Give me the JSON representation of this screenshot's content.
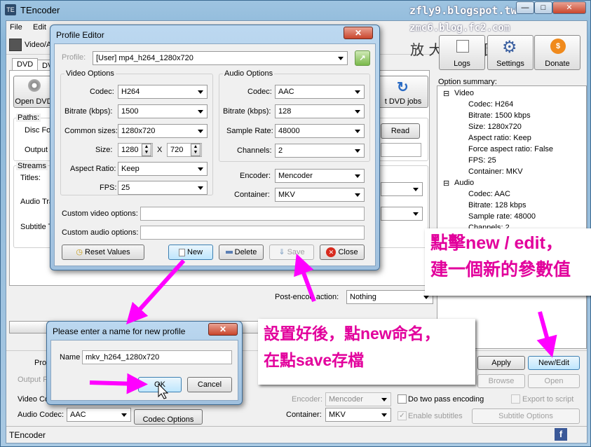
{
  "app": {
    "title": "TEncoder",
    "status": "TEncoder",
    "icon": "TE"
  },
  "watermark": {
    "line1": "zfly9.blogspot.tw",
    "line2": "zmc6.blog.fc2.com",
    "magnifier": "放 大 檢 視 圖"
  },
  "caption_buttons": {
    "min": "—",
    "max": "□",
    "close": "✕"
  },
  "menu": [
    "File",
    "Edit",
    "Tools",
    "Help"
  ],
  "toolbar": {
    "tab_label": "Video/A",
    "dvd_tab": "DVD",
    "dvd_tab2": "DV"
  },
  "main": {
    "open_dvd": "Open DVD",
    "dvd_jobs": "t DVD jobs",
    "paths": "Paths:",
    "disc_folder": "Disc Fo",
    "output": "Output",
    "read": "Read",
    "streams": "Streams",
    "titles": "Titles:",
    "audio_track": "Audio Tra",
    "subtitle_track": "Subtitle T",
    "post_encode_label": "Post-encod",
    "post_encode_label2": "action:",
    "post_encode_value": "Nothing",
    "profile_label": "Profi",
    "output_profile_label": "Output P",
    "video_codec_label": "Video Codec:",
    "audio_codec_label": "Audio Codec:",
    "audio_codec_value": "AAC",
    "codec_options": "Codec Options",
    "encoder_label": "Encoder:",
    "encoder_value": "Mencoder",
    "container_label": "Container:",
    "container_value": "MKV",
    "two_pass": "Do two pass encoding",
    "enable_subtitles": "Enable subtitles",
    "export_script": "Export to script",
    "subtitle_options": "Subtitle Options",
    "apply": "Apply",
    "new_edit": "New/Edit",
    "browse": "Browse",
    "open": "Open"
  },
  "right_panel": {
    "logs": "Logs",
    "settings": "Settings",
    "donate": "Donate",
    "option_summary": "Option summary:",
    "video_node": "Video",
    "video_items": [
      "Codec: H264",
      "Bitrate: 1500 kbps",
      "Size: 1280x720",
      "Aspect ratio: Keep",
      "Force aspect ratio: False",
      "FPS: 25",
      "Container: MKV"
    ],
    "audio_node": "Audio",
    "audio_items": [
      "Codec: AAC",
      "Bitrate: 128 kbps",
      "Sample rate: 48000",
      "Channels: 2"
    ]
  },
  "profile_editor": {
    "title": "Profile Editor",
    "profile_label": "Profile:",
    "profile_value": "[User] mp4_h264_1280x720",
    "video_options": "Video Options",
    "codec_label": "Codec:",
    "codec_value": "H264",
    "bitrate_label": "Bitrate (kbps):",
    "bitrate_value": "1500",
    "common_sizes_label": "Common sizes:",
    "common_sizes_value": "1280x720",
    "size_label": "Size:",
    "width": "1280",
    "x": "X",
    "height": "720",
    "aspect_label": "Aspect Ratio:",
    "aspect_value": "Keep",
    "fps_label": "FPS:",
    "fps_value": "25",
    "audio_options": "Audio Options",
    "acodec_label": "Codec:",
    "acodec_value": "AAC",
    "abitrate_label": "Bitrate (kbps):",
    "abitrate_value": "128",
    "sample_rate_label": "Sample Rate:",
    "sample_rate_value": "48000",
    "channels_label": "Channels:",
    "channels_value": "2",
    "encoder_label": "Encoder:",
    "encoder_value": "Mencoder",
    "container_label": "Container:",
    "container_value": "MKV",
    "custom_video": "Custom video options:",
    "custom_audio": "Custom audio options:",
    "reset": "Reset Values",
    "new": "New",
    "delete": "Delete",
    "save": "Save",
    "close": "Close"
  },
  "name_dialog": {
    "title": "Please enter a name for new profile",
    "name_label": "Name",
    "name_value": "mkv_h264_1280x720",
    "ok": "OK",
    "cancel": "Cancel"
  },
  "annotations": {
    "a1_line1": "點擊new / edit，",
    "a1_line2": "建一個新的參數值",
    "a2_line1": "設置好後，點new命名，",
    "a2_line2": "在點save存檔"
  },
  "colors": {
    "annotation": "#e2009c",
    "arrow": "#ff00ff"
  }
}
